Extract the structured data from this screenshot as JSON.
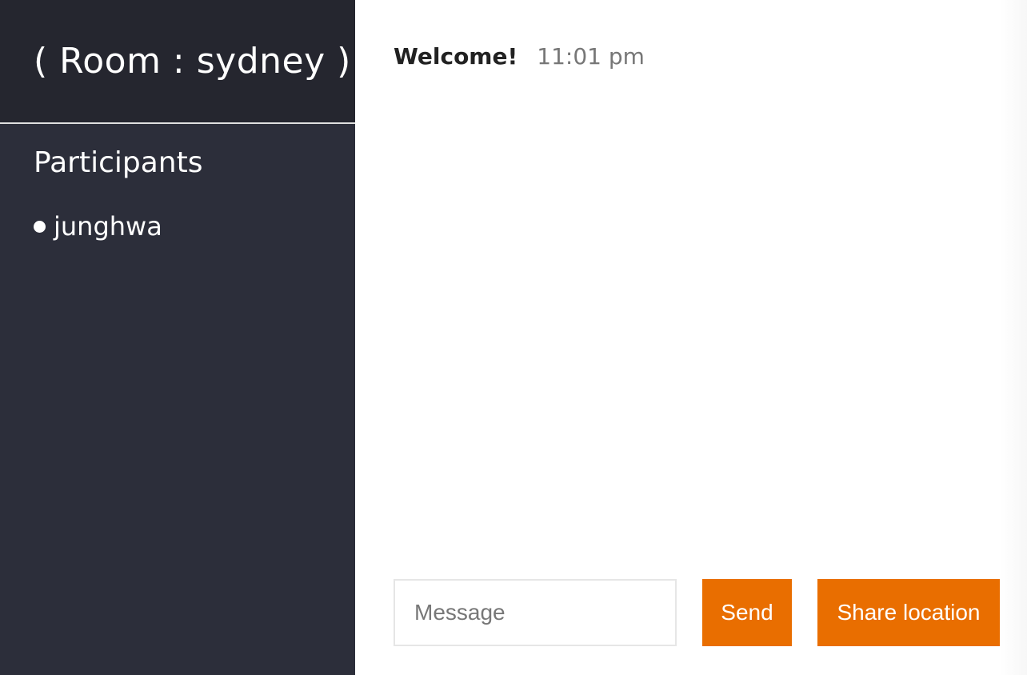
{
  "sidebar": {
    "room_title": "( Room : sydney )",
    "participants_heading": "Participants",
    "participants": [
      "junghwa"
    ]
  },
  "chat": {
    "messages": [
      {
        "username": "Welcome!",
        "time": "11:01 pm"
      }
    ]
  },
  "compose": {
    "placeholder": "Message",
    "send_label": "Send",
    "share_location_label": "Share location"
  },
  "colors": {
    "sidebar_bg": "#2c2e3a",
    "header_bg": "#25262f",
    "accent": "#e96e00"
  }
}
